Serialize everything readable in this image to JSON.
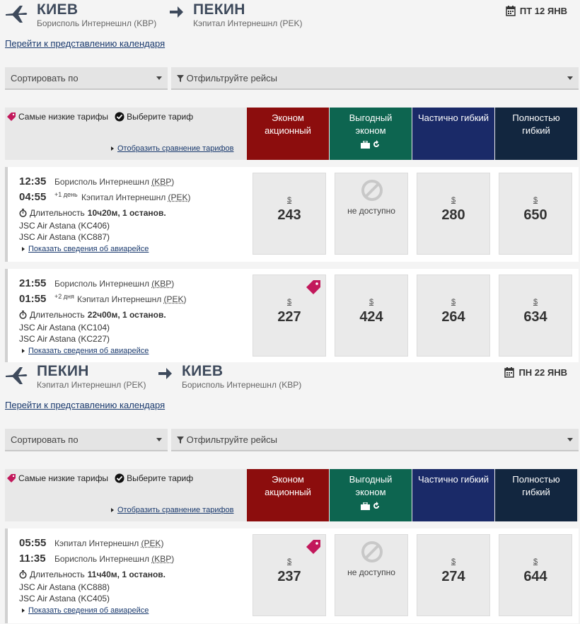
{
  "legs": [
    {
      "from_city": "КИЕВ",
      "from_airport": "Борисполь Интернешнл (KBP)",
      "to_city": "ПЕКИН",
      "to_airport": "Кэпитал Интернешнл (PEK)",
      "date": "ПТ 12 ЯНВ",
      "calendar_link": "Перейти к представлению календаря",
      "sort_label": "Сортировать по",
      "filter_label": "Отфильтруйте рейсы",
      "legend_lowest": "Самые низкие тарифы",
      "legend_select": "Выберите тариф",
      "compare_link": "Отобразить сравнение тарифов",
      "columns": [
        "Эконом акционный",
        "Выгодный эконом",
        "Частично гибкий",
        "Полностью гибкий"
      ],
      "flights": [
        {
          "dep_time": "12:35",
          "dep_airport": "Борисполь Интернешнл",
          "dep_code": "(KBP)",
          "arr_time": "04:55",
          "arr_plus": "+1 день",
          "arr_airport": "Кэпитал Интернешнл",
          "arr_code": "(PEK)",
          "duration_label": "Длительность",
          "duration_value": "10ч20м, 1 останов.",
          "carriers": [
            "JSC Air Astana (KC406)",
            "JSC Air Astana (KC887)"
          ],
          "details_link": "Показать сведения об авиарейсе",
          "fares": [
            {
              "currency": "$",
              "price": "243"
            },
            {
              "unavailable": "не доступно"
            },
            {
              "currency": "$",
              "price": "280"
            },
            {
              "currency": "$",
              "price": "650"
            }
          ]
        },
        {
          "dep_time": "21:55",
          "dep_airport": "Борисполь Интернешнл",
          "dep_code": "(KBP)",
          "arr_time": "01:55",
          "arr_plus": "+2 дня",
          "arr_airport": "Кэпитал Интернешнл",
          "arr_code": "(PEK)",
          "duration_label": "Длительность",
          "duration_value": "22ч00м, 1 останов.",
          "carriers": [
            "JSC Air Astana (KC104)",
            "JSC Air Astana (KC227)"
          ],
          "details_link": "Показать сведения об авиарейсе",
          "fares": [
            {
              "currency": "$",
              "price": "227"
            },
            {
              "currency": "$",
              "price": "424"
            },
            {
              "currency": "$",
              "price": "264"
            },
            {
              "currency": "$",
              "price": "634"
            }
          ]
        }
      ]
    },
    {
      "from_city": "ПЕКИН",
      "from_airport": "Кэпитал Интернешнл (PEK)",
      "to_city": "КИЕВ",
      "to_airport": "Борисполь Интернешнл (KBP)",
      "date": "ПН 22 ЯНВ",
      "calendar_link": "Перейти к представлению календаря",
      "sort_label": "Сортировать по",
      "filter_label": "Отфильтруйте рейсы",
      "legend_lowest": "Самые низкие тарифы",
      "legend_select": "Выберите тариф",
      "compare_link": "Отобразить сравнение тарифов",
      "columns": [
        "Эконом акционный",
        "Выгодный эконом",
        "Частично гибкий",
        "Полностью гибкий"
      ],
      "flights": [
        {
          "dep_time": "05:55",
          "dep_airport": "Кэпитал Интернешнл",
          "dep_code": "(PEK)",
          "arr_time": "11:35",
          "arr_plus": "",
          "arr_airport": "Борисполь Интернешнл",
          "arr_code": "(KBP)",
          "duration_label": "Длительность",
          "duration_value": "11ч40м, 1 останов.",
          "carriers": [
            "JSC Air Astana (KC888)",
            "JSC Air Astana (KC405)"
          ],
          "details_link": "Показать сведения об авиарейсе",
          "fares": [
            {
              "currency": "$",
              "price": "237"
            },
            {
              "unavailable": "не доступно"
            },
            {
              "currency": "$",
              "price": "274"
            },
            {
              "currency": "$",
              "price": "644"
            }
          ]
        }
      ]
    }
  ],
  "colors": {
    "economy_promo": "#8c0d0d",
    "economy_value": "#0d6550",
    "semi_flex": "#1a2a68",
    "full_flex": "#12263f",
    "lowest_tag": "#c2185b"
  },
  "icons": [
    "plane-icon",
    "arrow-right-icon",
    "calendar-icon",
    "tag-icon",
    "check-circle-icon",
    "filter-icon",
    "bag-icon",
    "refresh-icon",
    "stopwatch-icon",
    "unavailable-icon"
  ]
}
